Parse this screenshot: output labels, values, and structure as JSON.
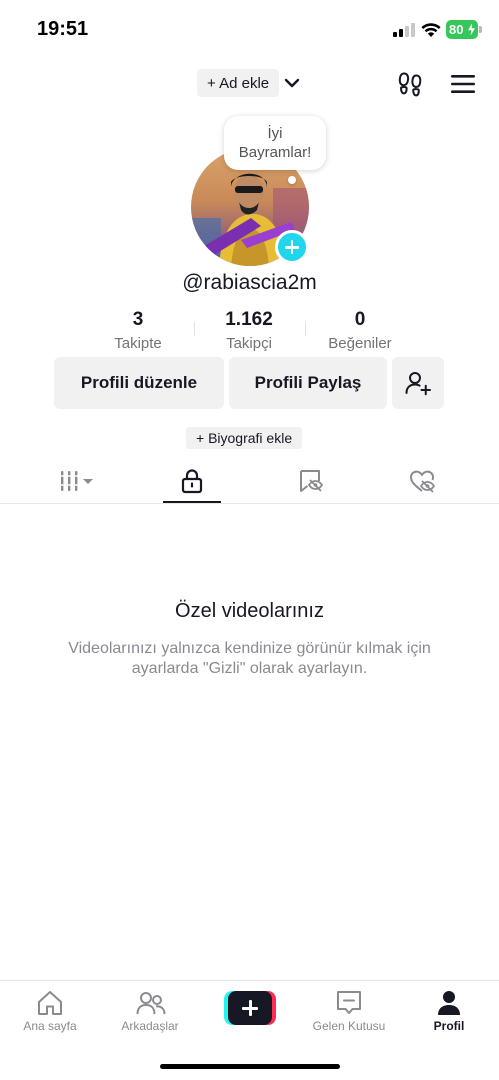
{
  "status_bar": {
    "time": "19:51",
    "battery": "80",
    "battery_color": "#35c759",
    "icons": [
      "signal-icon",
      "wifi-icon",
      "battery-icon"
    ]
  },
  "header": {
    "add_name_label": "+ Ad ekle",
    "icons": [
      "chevron-down-icon",
      "footprint-icon",
      "menu-icon"
    ]
  },
  "profile": {
    "bubble_text_line1": "İyi",
    "bubble_text_line2": "Bayramlar!",
    "username": "@rabiascia2m",
    "stats": [
      {
        "value": "3",
        "label": "Takipte"
      },
      {
        "value": "1.162",
        "label": "Takipçi"
      },
      {
        "value": "0",
        "label": "Beğeniler"
      }
    ],
    "edit_button": "Profili düzenle",
    "share_button": "Profili Paylaş",
    "add_bio": "+ Biyografi ekle"
  },
  "tabs": {
    "items": [
      "videos-grid-icon",
      "private-lock-icon",
      "reposts-icon",
      "liked-hidden-icon"
    ],
    "active": "private-lock-icon"
  },
  "empty_state": {
    "title": "Özel videolarınız",
    "description": "Videolarınızı yalnızca kendinize görünür kılmak için ayarlarda \"Gizli\" olarak ayarlayın."
  },
  "bottom_nav": {
    "items": [
      {
        "label": "Ana sayfa",
        "icon": "home-icon"
      },
      {
        "label": "Arkadaşlar",
        "icon": "friends-icon"
      },
      {
        "label": "",
        "icon": "create-plus-icon"
      },
      {
        "label": "Gelen Kutusu",
        "icon": "inbox-icon"
      },
      {
        "label": "Profil",
        "icon": "profile-icon"
      }
    ],
    "active": "Profil"
  },
  "colors": {
    "accent_cyan": "#25f4ee",
    "accent_red": "#fe2c55",
    "add_badge": "#20d5ec",
    "text_primary": "#161823",
    "text_secondary": "#8a8b91"
  }
}
